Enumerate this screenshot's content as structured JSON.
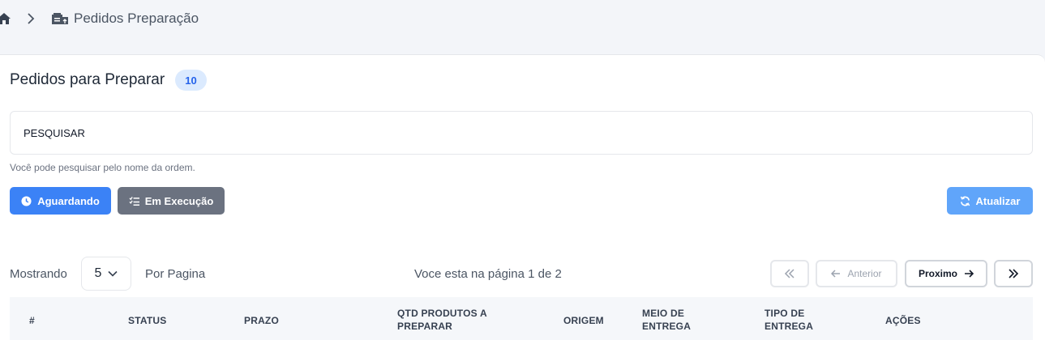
{
  "breadcrumb": {
    "title": "Pedidos Preparação"
  },
  "header": {
    "title": "Pedidos para Preparar",
    "count": "10"
  },
  "search": {
    "placeholder": "PESQUISAR",
    "value": "",
    "help": "Você pode pesquisar pelo nome da ordem."
  },
  "filters": {
    "waiting_label": "Aguardando",
    "executing_label": "Em Execução",
    "refresh_label": "Atualizar"
  },
  "pagination": {
    "showing_label": "Mostrando",
    "per_page_value": "5",
    "per_page_label": "Por Pagina",
    "page_info": "Voce esta na página 1 de 2",
    "prev_label": "Anterior",
    "next_label": "Proximo"
  },
  "table": {
    "columns": [
      "#",
      "STATUS",
      "PRAZO",
      "QTD PRODUTOS A PREPARAR",
      "ORIGEM",
      "MEIO DE ENTREGA",
      "TIPO DE ENTREGA",
      "AÇÕES"
    ]
  },
  "colors": {
    "primary": "#3b82f6",
    "secondary": "#6b7280",
    "refresh": "#60a5fa",
    "badge_bg": "#dbeafe",
    "badge_text": "#2563eb"
  },
  "icons": [
    "home-icon",
    "chevron-right-icon",
    "warehouse-icon",
    "clock-icon",
    "list-check-icon",
    "refresh-icon",
    "chevron-down-icon",
    "double-chevron-left-icon",
    "arrow-left-icon",
    "arrow-right-icon",
    "double-chevron-right-icon"
  ]
}
